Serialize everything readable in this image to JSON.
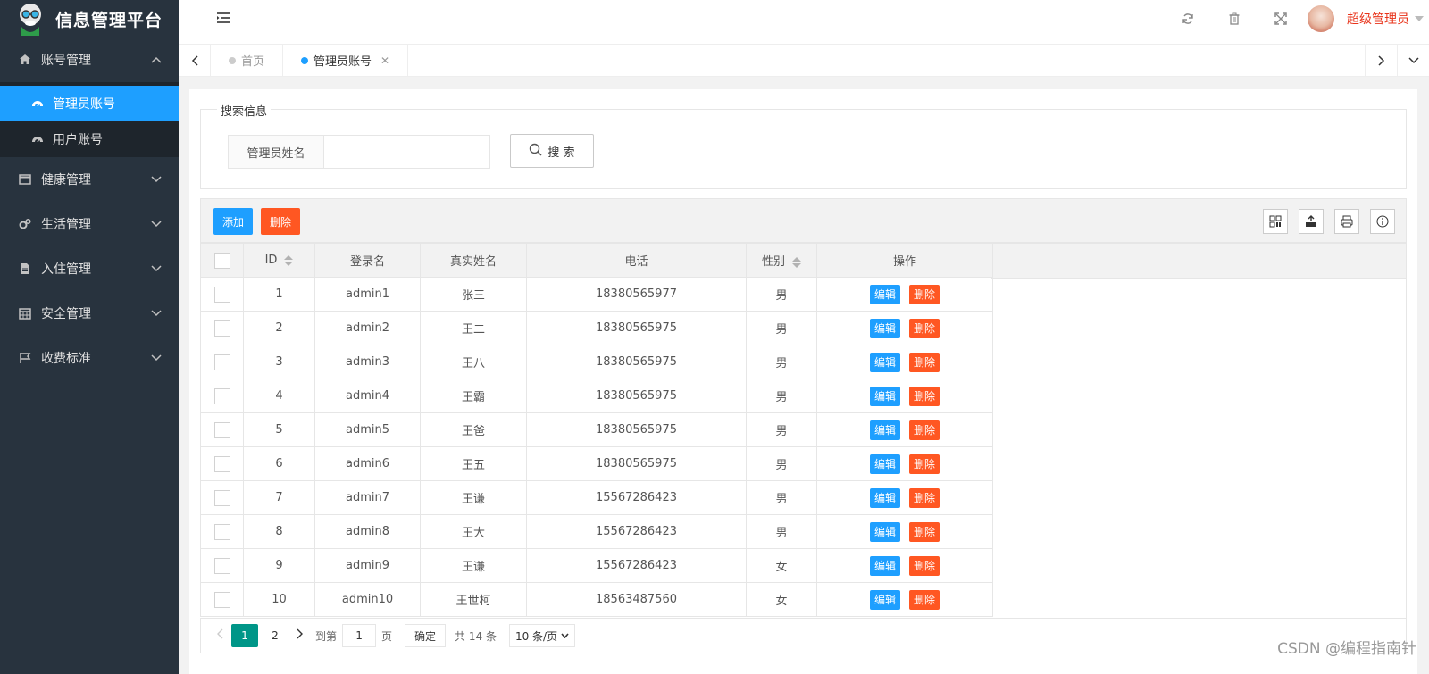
{
  "app": {
    "title": "信息管理平台",
    "user": "超级管理员"
  },
  "sidebar": {
    "groups": [
      {
        "label": "账号管理",
        "icon": "home-icon",
        "expanded": true,
        "items": [
          {
            "label": "管理员账号",
            "active": true
          },
          {
            "label": "用户账号",
            "active": false
          }
        ]
      },
      {
        "label": "健康管理",
        "icon": "window-icon"
      },
      {
        "label": "生活管理",
        "icon": "gears-icon"
      },
      {
        "label": "入住管理",
        "icon": "file-icon"
      },
      {
        "label": "安全管理",
        "icon": "calendar-icon"
      },
      {
        "label": "收费标准",
        "icon": "flag-icon"
      }
    ]
  },
  "tabs": [
    {
      "label": "首页",
      "active": false
    },
    {
      "label": "管理员账号",
      "active": true
    }
  ],
  "search": {
    "legend": "搜索信息",
    "field_label": "管理员姓名",
    "field_value": "",
    "button": "搜 索"
  },
  "toolbar": {
    "add": "添加",
    "delete": "删除"
  },
  "table": {
    "headers": [
      "ID",
      "登录名",
      "真实姓名",
      "电话",
      "性别",
      "操作"
    ],
    "edit_label": "编辑",
    "delete_label": "删除",
    "rows": [
      {
        "id": "1",
        "login": "admin1",
        "name": "张三",
        "phone": "18380565977",
        "gender": "男"
      },
      {
        "id": "2",
        "login": "admin2",
        "name": "王二",
        "phone": "18380565975",
        "gender": "男"
      },
      {
        "id": "3",
        "login": "admin3",
        "name": "王八",
        "phone": "18380565975",
        "gender": "男"
      },
      {
        "id": "4",
        "login": "admin4",
        "name": "王霸",
        "phone": "18380565975",
        "gender": "男"
      },
      {
        "id": "5",
        "login": "admin5",
        "name": "王爸",
        "phone": "18380565975",
        "gender": "男"
      },
      {
        "id": "6",
        "login": "admin6",
        "name": "王五",
        "phone": "18380565975",
        "gender": "男"
      },
      {
        "id": "7",
        "login": "admin7",
        "name": "王谦",
        "phone": "15567286423",
        "gender": "男"
      },
      {
        "id": "8",
        "login": "admin8",
        "name": "王大",
        "phone": "15567286423",
        "gender": "男"
      },
      {
        "id": "9",
        "login": "admin9",
        "name": "王谦",
        "phone": "15567286423",
        "gender": "女"
      },
      {
        "id": "10",
        "login": "admin10",
        "name": "王世柯",
        "phone": "18563487560",
        "gender": "女"
      }
    ]
  },
  "pager": {
    "pages": [
      "1",
      "2"
    ],
    "current": "1",
    "goto_label": "到第",
    "goto_value": "1",
    "page_unit": "页",
    "ok": "确定",
    "total": "共 14 条",
    "per_page": "10 条/页"
  },
  "watermark": "CSDN @编程指南针",
  "colors": {
    "sidebar_bg": "#28333e",
    "active_blue": "#1e9fff",
    "danger": "#ff5722",
    "pager_active": "#009688",
    "admin_name": "#e8331a"
  }
}
